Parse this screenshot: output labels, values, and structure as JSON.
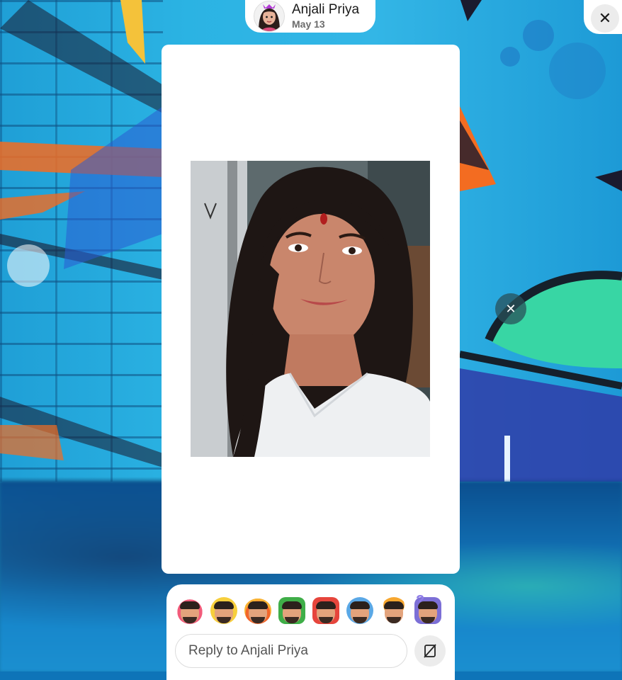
{
  "header": {
    "user_name": "Anjali Priya",
    "post_date": "May 13"
  },
  "controls": {
    "close_icon": "close-icon",
    "close_glyph": "✕",
    "dismiss_glyph": "✕"
  },
  "reactions": [
    {
      "name": "heart-eyes-reaction"
    },
    {
      "name": "laughing-reaction"
    },
    {
      "name": "fire-reaction"
    },
    {
      "name": "thumbs-up-reaction"
    },
    {
      "name": "thumbs-down-reaction"
    },
    {
      "name": "sad-reaction"
    },
    {
      "name": "mind-blown-reaction"
    },
    {
      "name": "question-reaction"
    }
  ],
  "reply": {
    "placeholder": "Reply to Anjali Priya"
  },
  "colors": {
    "background_accent": "#2bb3e3",
    "card": "#ffffff"
  }
}
